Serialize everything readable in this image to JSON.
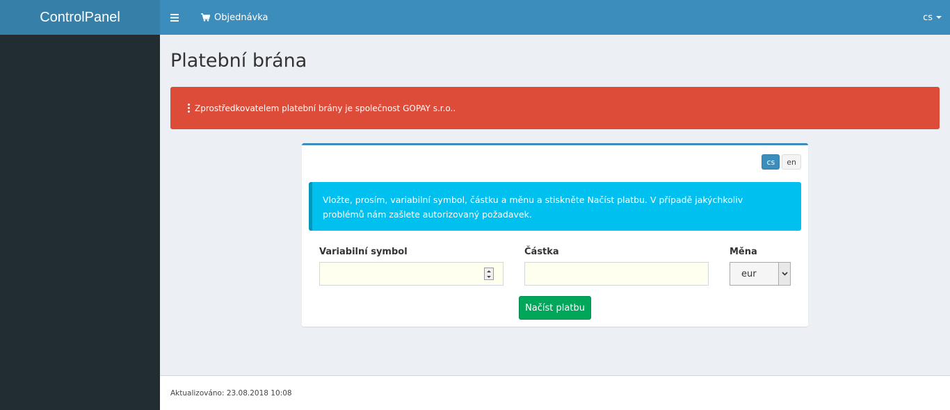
{
  "brand": {
    "title": "ControlPanel"
  },
  "header": {
    "nav_order": "Objednávka",
    "lang_current": "cs"
  },
  "page": {
    "title": "Platební brána",
    "alert": "Zprostředkovatelem platební brány je společnost GOPAY s.r.o.."
  },
  "box": {
    "languages": [
      "cs",
      "en"
    ],
    "info": "Vložte, prosím, variabilní symbol, částku a měnu a stiskněte Načíst platbu. V případě jakýchkoliv problémů nám zašlete autorizovaný požadavek.",
    "fields": {
      "vs_label": "Variabilní symbol",
      "vs_value": "",
      "amount_label": "Částka",
      "amount_value": "",
      "currency_label": "Měna",
      "currency_value": "eur"
    },
    "submit_label": "Načíst platbu"
  },
  "footer": {
    "updated": "Aktualizováno: 23.08.2018 10:08"
  },
  "colors": {
    "primary": "#3c8dbc",
    "danger": "#dd4b39",
    "info": "#00c0ef",
    "success": "#00a65a",
    "sidebar": "#222d32"
  },
  "icons": [
    "hamburger-icon",
    "cart-icon",
    "caret-down-icon",
    "exclamation-icon",
    "spinner-icon",
    "chevron-down-icon"
  ]
}
